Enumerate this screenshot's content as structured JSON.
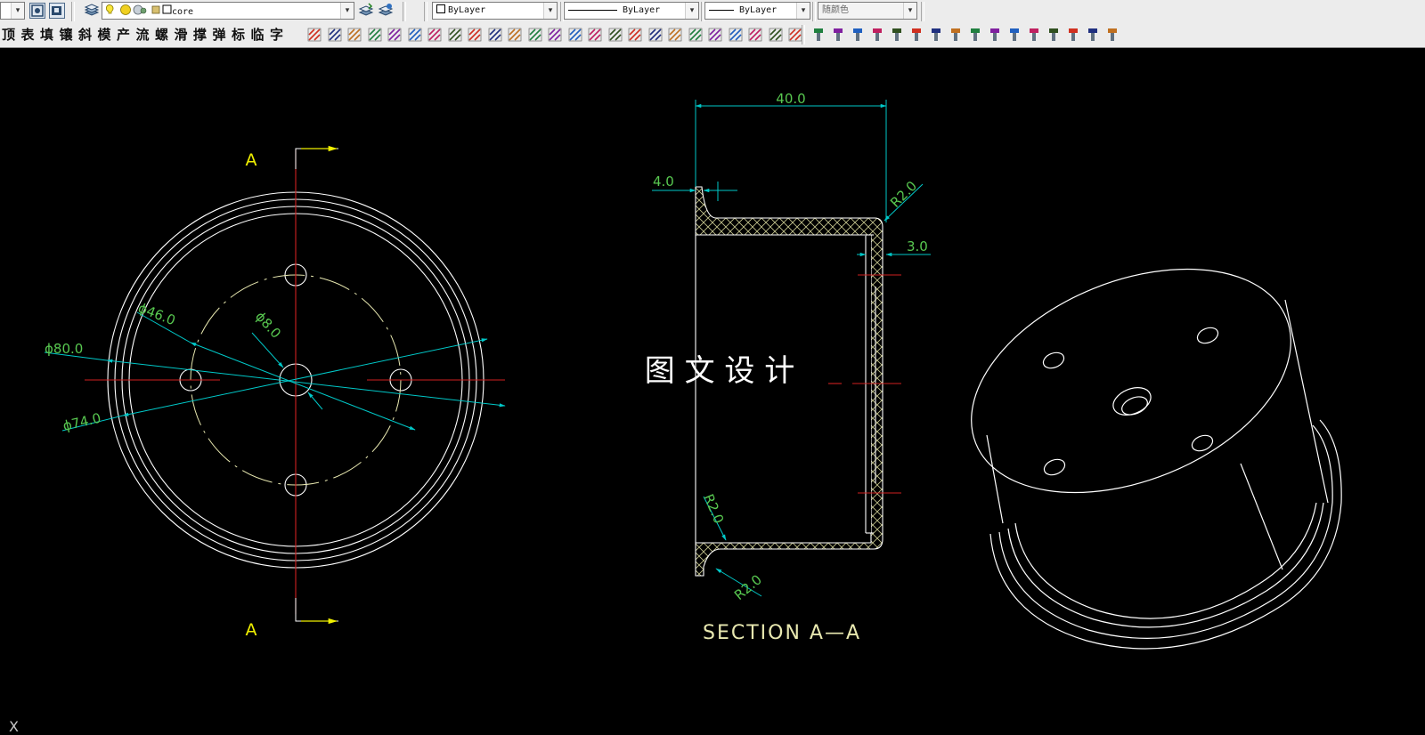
{
  "toolbar_top": {
    "layer_combo": {
      "value": "core"
    },
    "color_combo": {
      "value": "ByLayer"
    },
    "linetype_combo": {
      "value": "ByLayer"
    },
    "lineweight_combo": {
      "value": "ByLayer"
    },
    "plotstyle_combo": {
      "value": "随颜色",
      "disabled": true
    }
  },
  "toolbar_menu": {
    "items": [
      "顶",
      "表",
      "填",
      "镶",
      "斜",
      "模",
      "产",
      "流",
      "螺",
      "滑",
      "撑",
      "弹",
      "标",
      "临",
      "字"
    ]
  },
  "drawing": {
    "section_marker_top": "A",
    "section_marker_bottom": "A",
    "dimensions": {
      "outer_diameter": "ϕ80.0",
      "inner_diameter": "ϕ74.0",
      "bolt_circle": "ϕ46.0",
      "center_hole": "ϕ8.0",
      "width": "40.0",
      "flange": "4.0",
      "wall": "3.0",
      "radius_top": "R2.0",
      "radius_inner": "R2.0",
      "radius_bottom": "R2.0"
    },
    "section_label": "SECTION A—A",
    "watermark": "图 文 设 计",
    "ucs_icon_label": "X"
  },
  "colors": {
    "background": "#000000",
    "geometry": "#ffffff",
    "dimension_line": "#00c8c8",
    "dimension_text": "#58c850",
    "center_line": "#d02020",
    "hidden_circle": "#e8e8b0",
    "section_marker": "#f0f000",
    "hatch": "#c8c890"
  }
}
